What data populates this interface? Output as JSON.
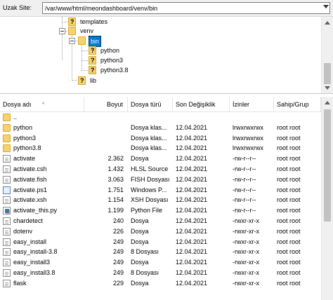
{
  "path": {
    "label": "Uzak Site:",
    "value": "/var/www/html/meondashboard/venv/bin"
  },
  "tree": {
    "nodes": [
      {
        "label": "templates"
      },
      {
        "label": "venv"
      },
      {
        "label": "bin"
      },
      {
        "label": "python"
      },
      {
        "label": "python3"
      },
      {
        "label": "python3.8"
      },
      {
        "label": "lib"
      }
    ]
  },
  "columns": {
    "name": "Dosya adı",
    "size": "Boyut",
    "type": "Dosya türü",
    "date": "Son Değişiklik",
    "perm": "İzinler",
    "owner": "Sahip/Grup"
  },
  "files": [
    {
      "name": "..",
      "size": "",
      "type": "",
      "date": "",
      "perm": "",
      "owner": "",
      "icon": "folder-icon"
    },
    {
      "name": "python",
      "size": "",
      "type": "Dosya klas...",
      "date": "12.04.2021",
      "perm": "lrwxrwxrwx",
      "owner": "root root",
      "icon": "folder-icon"
    },
    {
      "name": "python3",
      "size": "",
      "type": "Dosya klas...",
      "date": "12.04.2021",
      "perm": "lrwxrwxrwx",
      "owner": "root root",
      "icon": "folder-icon"
    },
    {
      "name": "python3.8",
      "size": "",
      "type": "Dosya klas...",
      "date": "12.04.2021",
      "perm": "lrwxrwxrwx",
      "owner": "root root",
      "icon": "folder-icon"
    },
    {
      "name": "activate",
      "size": "2.362",
      "type": "Dosya",
      "date": "12.04.2021",
      "perm": "-rw-r--r--",
      "owner": "root root",
      "icon": "file-icon"
    },
    {
      "name": "activate.csh",
      "size": "1.432",
      "type": "HLSL Source",
      "date": "12.04.2021",
      "perm": "-rw-r--r--",
      "owner": "root root",
      "icon": "file-icon"
    },
    {
      "name": "activate.fish",
      "size": "3.063",
      "type": "FISH Dosyası",
      "date": "12.04.2021",
      "perm": "-rw-r--r--",
      "owner": "root root",
      "icon": "file-icon"
    },
    {
      "name": "activate.ps1",
      "size": "1.751",
      "type": "Windows P...",
      "date": "12.04.2021",
      "perm": "-rw-r--r--",
      "owner": "root root",
      "icon": "powershell-file-icon"
    },
    {
      "name": "activate.xsh",
      "size": "1.154",
      "type": "XSH Dosyası",
      "date": "12.04.2021",
      "perm": "-rw-r--r--",
      "owner": "root root",
      "icon": "file-icon"
    },
    {
      "name": "activate_this.py",
      "size": "1.199",
      "type": "Python File",
      "date": "12.04.2021",
      "perm": "-rw-r--r--",
      "owner": "root root",
      "icon": "python-file-icon"
    },
    {
      "name": "chardetect",
      "size": "240",
      "type": "Dosya",
      "date": "12.04.2021",
      "perm": "-rwxr-xr-x",
      "owner": "root root",
      "icon": "file-icon"
    },
    {
      "name": "dotenv",
      "size": "226",
      "type": "Dosya",
      "date": "12.04.2021",
      "perm": "-rwxr-xr-x",
      "owner": "root root",
      "icon": "file-icon"
    },
    {
      "name": "easy_install",
      "size": "249",
      "type": "Dosya",
      "date": "12.04.2021",
      "perm": "-rwxr-xr-x",
      "owner": "root root",
      "icon": "file-icon"
    },
    {
      "name": "easy_install-3.8",
      "size": "249",
      "type": "8 Dosyası",
      "date": "12.04.2021",
      "perm": "-rwxr-xr-x",
      "owner": "root root",
      "icon": "file-icon"
    },
    {
      "name": "easy_install3",
      "size": "249",
      "type": "Dosya",
      "date": "12.04.2021",
      "perm": "-rwxr-xr-x",
      "owner": "root root",
      "icon": "file-icon"
    },
    {
      "name": "easy_install3.8",
      "size": "249",
      "type": "8 Dosyası",
      "date": "12.04.2021",
      "perm": "-rwxr-xr-x",
      "owner": "root root",
      "icon": "file-icon"
    },
    {
      "name": "flask",
      "size": "229",
      "type": "Dosya",
      "date": "12.04.2021",
      "perm": "-rwxr-xr-x",
      "owner": "root root",
      "icon": "file-icon"
    }
  ]
}
